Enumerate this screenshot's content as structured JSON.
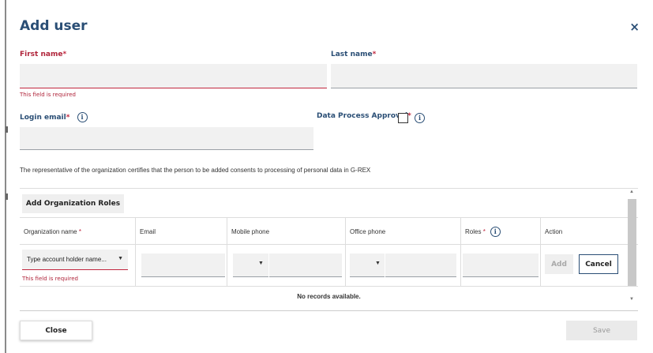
{
  "dialog": {
    "title": "Add user",
    "close_icon": "×"
  },
  "form": {
    "first_name_label": "First name",
    "last_name_label": "Last name",
    "required_mark": "*",
    "first_name_error": "This field is required",
    "login_email_label": "Login email",
    "data_process_label": "Data Process Approval",
    "info_icon": "i",
    "notice": "The representative of the organization certifies that the person to be added consents to processing of personal data in G-REX"
  },
  "grid": {
    "add_roles_label": "Add Organization Roles",
    "columns": {
      "org_name": "Organization name",
      "email": "Email",
      "mobile": "Mobile phone",
      "office": "Office phone",
      "roles": "Roles",
      "action": "Action"
    },
    "row": {
      "org_placeholder": "Type account holder name...",
      "org_caret": "▼",
      "org_error": "This field is required",
      "mobile_caret": "▼",
      "office_caret": "▼",
      "add_label": "Add",
      "cancel_label": "Cancel"
    },
    "empty_text": "No records available.",
    "scroll_up": "▲",
    "scroll_down": "▼"
  },
  "footer": {
    "close_label": "Close",
    "save_label": "Save"
  },
  "colors": {
    "title": "#2a4e75",
    "error": "#b0243a",
    "input_bg": "#f1f1f1"
  }
}
